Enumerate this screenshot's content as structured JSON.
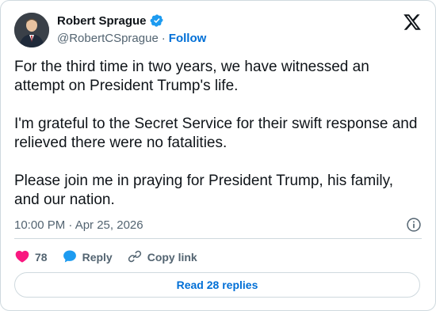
{
  "author": {
    "display_name": "Robert Sprague",
    "handle": "@RobertCSprague",
    "separator": "·",
    "follow_label": "Follow"
  },
  "tweet": {
    "paragraphs": [
      "For the third time in two years, we have witnessed an attempt on President Trump's life.",
      "I'm grateful to the Secret Service for their swift response and relieved there were no fatalities.",
      "Please join me in praying for President Trump, his family, and our nation."
    ],
    "timestamp": "10:00 PM · Apr 25, 2026"
  },
  "actions": {
    "like_count": "78",
    "reply_label": "Reply",
    "copy_link_label": "Copy link"
  },
  "read_replies_label": "Read 28 replies",
  "colors": {
    "like": "#f91880",
    "reply": "#1d9bf0",
    "link": "#006fd6",
    "verified": "#1d9bf0",
    "muted": "#536471"
  },
  "icons": [
    "verified-badge-icon",
    "x-logo-icon",
    "info-icon",
    "heart-icon",
    "reply-bubble-icon",
    "link-icon"
  ]
}
